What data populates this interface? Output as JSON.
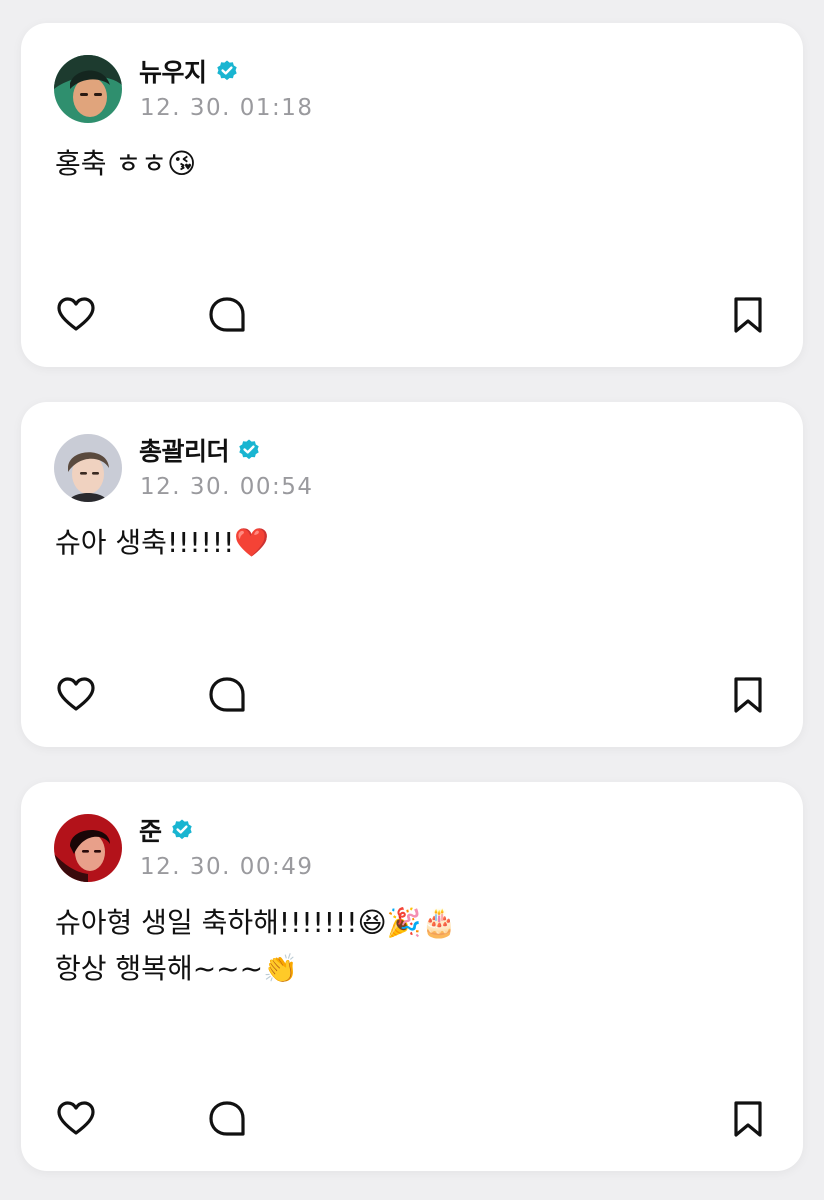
{
  "posts": [
    {
      "author": "뉴우지",
      "verified": true,
      "timestamp": "12. 30. 01:18",
      "lines": [
        "홍축 ㅎㅎ😘"
      ],
      "avatar_palette": [
        "#2f8f6e",
        "#1d3b2f",
        "#e0a47c"
      ]
    },
    {
      "author": "총괄리더",
      "verified": true,
      "timestamp": "12. 30. 00:54",
      "lines": [
        "슈아 생축!!!!!!❤️"
      ],
      "avatar_palette": [
        "#c9ccd6",
        "#5a4a3e",
        "#f0d2c0"
      ]
    },
    {
      "author": "준",
      "verified": true,
      "timestamp": "12. 30. 00:49",
      "lines": [
        "슈아형 생일 축하해!!!!!!!😆🎉🎂",
        "항상 행복해~~~👏"
      ],
      "avatar_palette": [
        "#b3121a",
        "#3a0a0c",
        "#e8a08a"
      ]
    }
  ],
  "icons": {
    "like": "heart-outline-icon",
    "comment": "speech-bubble-icon",
    "save": "bookmark-icon",
    "verified": "verified-badge-icon"
  },
  "colors": {
    "verified_badge": "#19b5d1",
    "timestamp": "#9a9a9e",
    "background": "#efeff1",
    "card": "#ffffff"
  }
}
